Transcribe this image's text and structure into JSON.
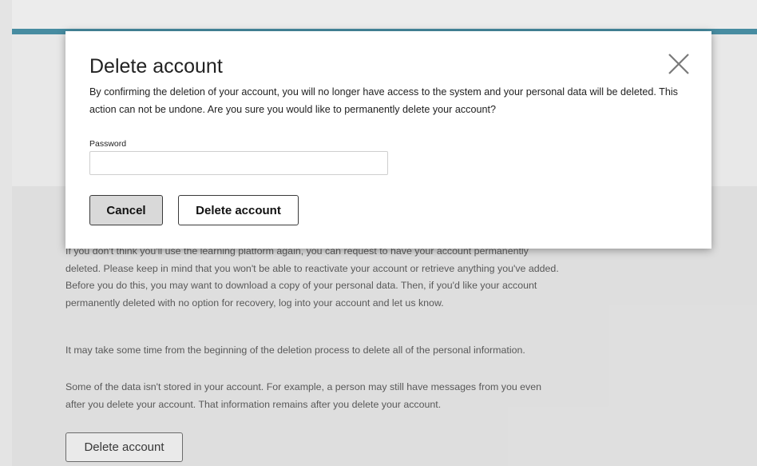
{
  "page": {
    "paragraphs": [
      "If you don't think you'll use the learning platform again, you can request to have your account permanently deleted. Please keep in mind that you won't be able to reactivate your account or retrieve anything you've added. Before you do this, you may want to download a copy of your personal data. Then, if you'd like your account permanently deleted with no option for recovery, log into your account and let us know.",
      "It may take some time from the beginning of the deletion process to delete all of the personal information.",
      "Some of the data isn't stored in your account. For example, a person may still have messages from you even after you delete your account. That information remains after you delete your account."
    ],
    "delete_button_label": "Delete account",
    "accent_color": "#4a91a7"
  },
  "modal": {
    "title": "Delete account",
    "description": "By confirming the deletion of your account, you will no longer have access to the system and your personal data will be deleted. This action can not be undone. Are you sure you would like to permanently delete your account?",
    "password_label": "Password",
    "password_value": "",
    "cancel_label": "Cancel",
    "confirm_label": "Delete account",
    "close_icon": "close-icon"
  }
}
